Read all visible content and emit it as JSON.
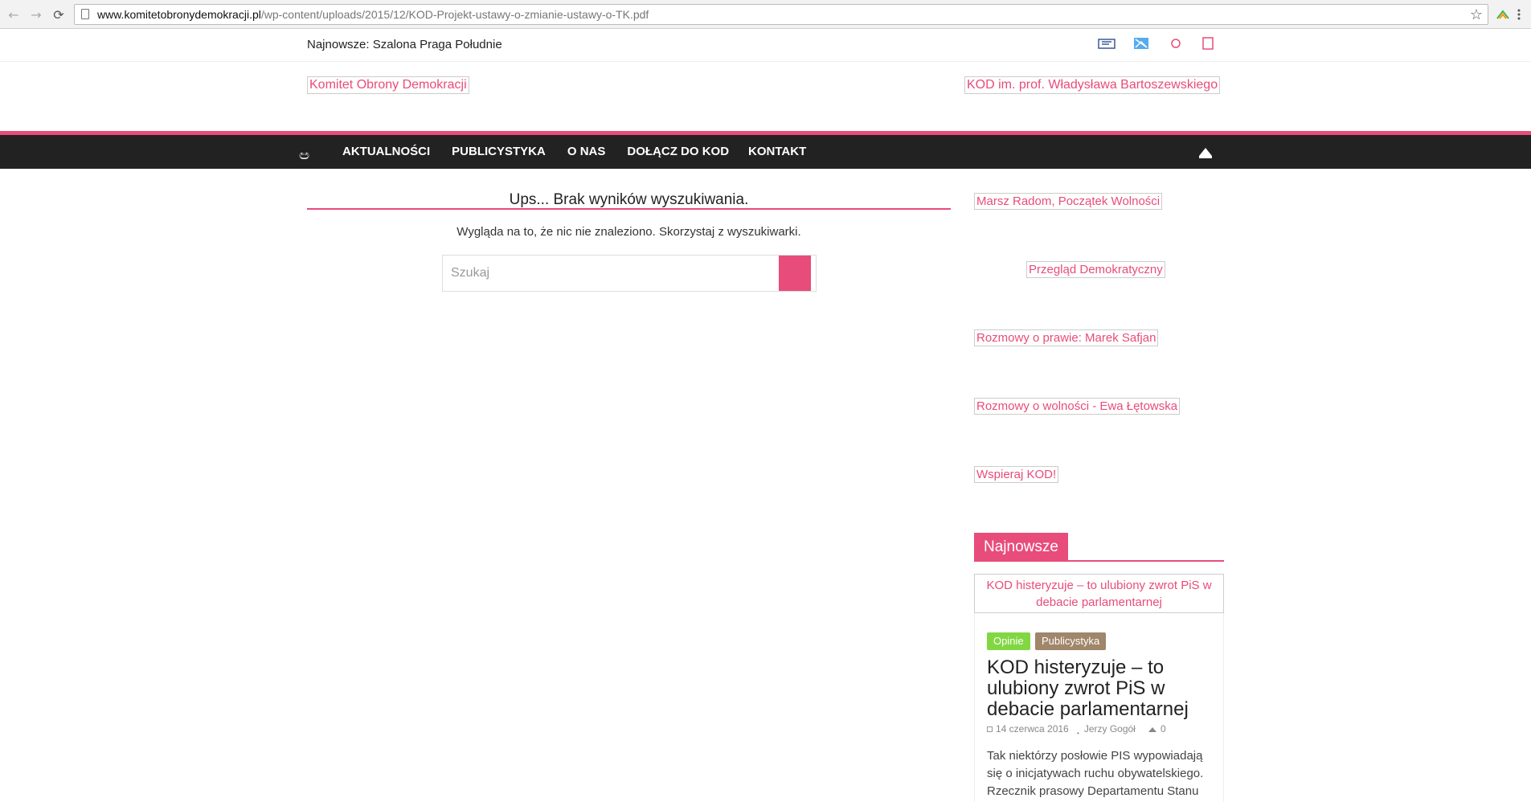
{
  "browser": {
    "url_domain": "www.komitetobronydemokracji.pl",
    "url_path": "/wp-content/uploads/2015/12/KOD-Projekt-ustawy-o-zmianie-ustawy-o-TK.pdf",
    "back_glyph": "←",
    "forward_glyph": "→",
    "reload_glyph": "⟳",
    "star_glyph": "☆"
  },
  "topbar": {
    "latest_label": "Najnowsze:",
    "latest_link": "Szalona Praga Południe"
  },
  "header": {
    "logo_alt": "Komitet Obrony Demokracji",
    "patron_alt": "KOD im. prof. Władysława Bartoszewskiego"
  },
  "nav": {
    "items": [
      {
        "label": "AKTUALNOŚCI",
        "caret": ""
      },
      {
        "label": "PUBLICYSTYKA",
        "caret": ""
      },
      {
        "label": "O NAS",
        "caret": ""
      },
      {
        "label": "DOŁĄCZ DO KOD",
        "caret": ""
      },
      {
        "label": "KONTAKT",
        "caret": ""
      }
    ],
    "search_glyph": "",
    "home_glyph": "ඏ"
  },
  "content": {
    "title": "Ups... Brak wyników wyszukiwania.",
    "text": "Wygląda na to, że nic nie znaleziono. Skorzystaj z wyszukiwarki.",
    "search_placeholder": "Szukaj",
    "search_button_glyph": ""
  },
  "sidebar": {
    "images": [
      "Marsz Radom, Początek Wolności",
      "Przegląd Demokratyczny",
      "Rozmowy o prawie: Marek Safjan",
      "Rozmowy o wolności - Ewa Łętowska",
      "Wspieraj KOD!"
    ],
    "widget_title": "Najnowsze",
    "post": {
      "thumb_alt": "KOD histeryzuje – to ulubiony zwrot PiS w debacie parlamentarnej",
      "categories": [
        {
          "label": "Opinie",
          "color": "#81d742"
        },
        {
          "label": "Publicystyka",
          "color": "#a0866a"
        }
      ],
      "title": "KOD histeryzuje – to ulubiony zwrot PiS w debacie parlamentarnej",
      "date": "14 czerwca 2016",
      "author": "Jerzy Gogół",
      "comments": "0",
      "excerpt": "Tak niektórzy posłowie PIS wypowiadają się o inicjatywach ruchu obywatelskiego. Rzecznik prasowy Departamentu Stanu"
    }
  },
  "colors": {
    "accent": "#e84c7a",
    "nav_bg": "#222222"
  }
}
